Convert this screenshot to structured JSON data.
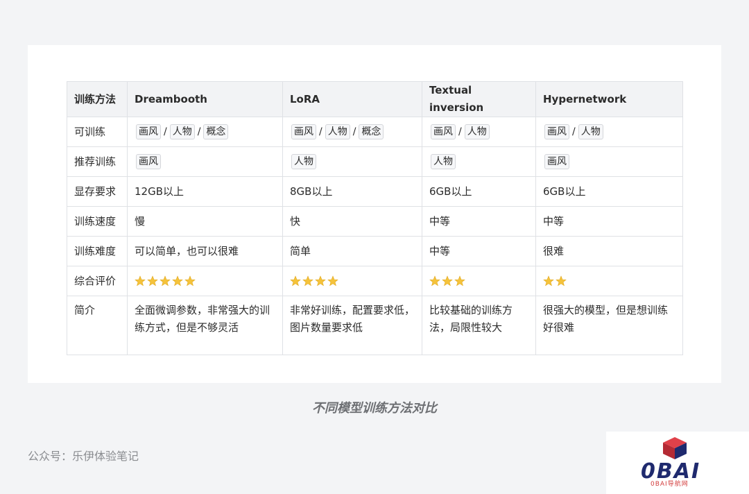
{
  "table": {
    "headers": [
      "训练方法",
      "Dreambooth",
      "LoRA",
      "Textual inversion",
      "Hypernetwork"
    ],
    "rows": {
      "trainable": {
        "label": "可训练",
        "dreambooth": [
          "画风",
          "人物",
          "概念"
        ],
        "lora": [
          "画风",
          "人物",
          "概念"
        ],
        "textual": [
          "画风",
          "人物"
        ],
        "hyper": [
          "画风",
          "人物"
        ]
      },
      "recommended": {
        "label": "推荐训练",
        "dreambooth": "画风",
        "lora": "人物",
        "textual": "人物",
        "hyper": "画风"
      },
      "vram": {
        "label": "显存要求",
        "dreambooth": "12GB以上",
        "lora": "8GB以上",
        "textual": "6GB以上",
        "hyper": "6GB以上"
      },
      "speed": {
        "label": "训练速度",
        "dreambooth": "慢",
        "lora": "快",
        "textual": "中等",
        "hyper": "中等"
      },
      "difficulty": {
        "label": "训练难度",
        "dreambooth": "可以简单，也可以很难",
        "lora": "简单",
        "textual": "中等",
        "hyper": "很难"
      },
      "rating": {
        "label": "综合评价",
        "dreambooth": 5,
        "lora": 4,
        "textual": 3,
        "hyper": 2
      },
      "intro": {
        "label": "简介",
        "dreambooth": "全面微调参数，非常强大的训练方式，但是不够灵活",
        "lora": "非常好训练，配置要求低，图片数量要求低",
        "textual": "比较基础的训练方法，局限性较大",
        "hyper": "很强大的模型，但是想训练好很难"
      }
    },
    "tag_separator": "/"
  },
  "caption": "不同模型训练方法对比",
  "author": "公众号：乐伊体验笔记",
  "logo": {
    "text": "0BAI",
    "sub": "0BAI导航网"
  },
  "colors": {
    "star": "#f5c33b",
    "logo_red": "#d93a3a",
    "logo_navy": "#1f2a6e"
  },
  "icons": {
    "rating": "star-icon",
    "logo": "cube-icon"
  }
}
